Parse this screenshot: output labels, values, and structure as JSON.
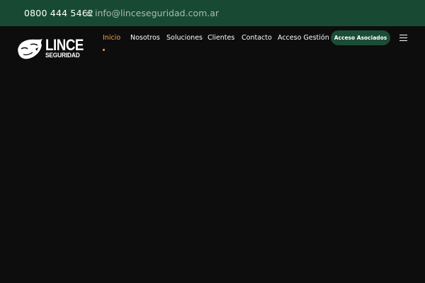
{
  "topbar": {
    "phone": "0800 444 5462",
    "email": "info@linceseguridad.com.ar",
    "email_icon": "envelope-icon"
  },
  "brand": {
    "name": "LINCE",
    "subtitle": "SEGURIDAD",
    "logo_icon": "lynx-head-icon"
  },
  "nav": {
    "items": [
      {
        "label": "Inicio",
        "active": true
      },
      {
        "label": "Nosotros",
        "active": false
      },
      {
        "label": "Soluciones",
        "active": false
      },
      {
        "label": "Clientes",
        "active": false
      },
      {
        "label": "Contacto",
        "active": false
      },
      {
        "label": "Acceso Gestión",
        "active": false
      }
    ],
    "cta_label": "Acceso Asociados",
    "menu_icon": "hamburger-menu-icon"
  },
  "colors": {
    "topbar_bg": "#184a33",
    "page_bg": "#0d0d0d",
    "accent": "#f2a93b",
    "cta_bg": "#1b4d36"
  }
}
